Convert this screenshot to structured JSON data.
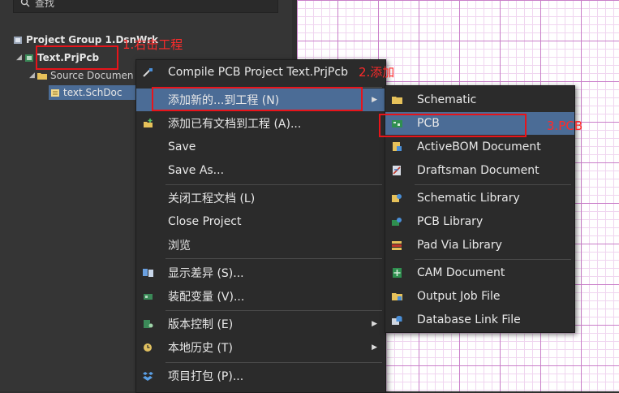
{
  "search": {
    "placeholder": "查找"
  },
  "tree": {
    "group": "Project Group 1.DsnWrk",
    "project": "Text.PrjPcb",
    "folder": "Source Documen",
    "doc": "text.SchDoc"
  },
  "annotations": {
    "step1": "1.右击工程",
    "step2": "2.添加",
    "step3": "3.PCB"
  },
  "context_menu": {
    "items": [
      {
        "label": "Compile PCB Project Text.PrjPcb",
        "icon": "compile-icon"
      },
      {
        "label": "添加新的...到工程 (N)",
        "icon": "",
        "submenu": true
      },
      {
        "label": "添加已有文档到工程 (A)...",
        "icon": "add-existing-icon"
      },
      {
        "label": "Save",
        "icon": ""
      },
      {
        "label": "Save As...",
        "icon": ""
      },
      {
        "label": "关闭工程文档 (L)",
        "icon": ""
      },
      {
        "label": "Close Project",
        "icon": ""
      },
      {
        "label": "浏览",
        "icon": ""
      },
      {
        "label": "显示差异 (S)...",
        "icon": "diff-icon"
      },
      {
        "label": "装配变量 (V)...",
        "icon": "variant-icon"
      },
      {
        "label": "版本控制 (E)",
        "icon": "version-control-icon",
        "submenu": true
      },
      {
        "label": "本地历史 (T)",
        "icon": "history-icon",
        "submenu": true
      },
      {
        "label": "项目打包 (P)...",
        "icon": "package-icon"
      }
    ]
  },
  "submenu": {
    "items": [
      {
        "label": "Schematic",
        "icon": "schematic-icon"
      },
      {
        "label": "PCB",
        "icon": "pcb-icon"
      },
      {
        "label": "ActiveBOM Document",
        "icon": "bom-icon"
      },
      {
        "label": "Draftsman Document",
        "icon": "draftsman-icon"
      },
      {
        "label": "Schematic Library",
        "icon": "schlib-icon"
      },
      {
        "label": "PCB Library",
        "icon": "pcblib-icon"
      },
      {
        "label": "Pad Via Library",
        "icon": "padvia-icon"
      },
      {
        "label": "CAM Document",
        "icon": "cam-icon"
      },
      {
        "label": "Output Job File",
        "icon": "outjob-icon"
      },
      {
        "label": "Database Link File",
        "icon": "dblink-icon"
      }
    ]
  },
  "colors": {
    "highlight": "#4b6c96",
    "annotation": "#e8141a",
    "grid_major": "#c97fc9"
  }
}
